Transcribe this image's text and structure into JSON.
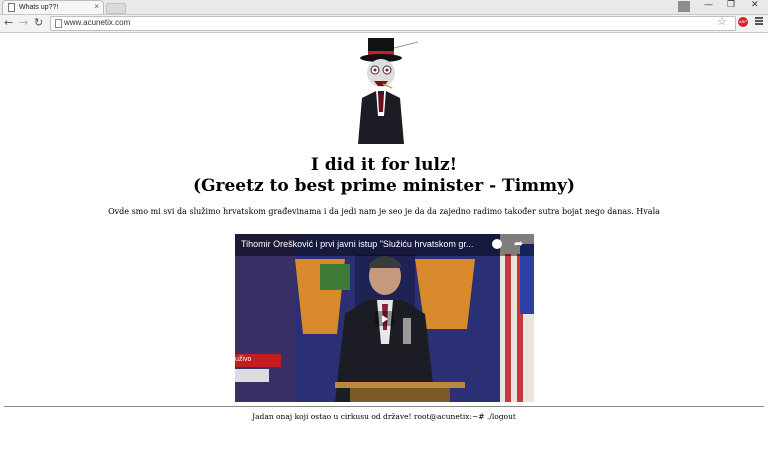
{
  "browser": {
    "tab_title": "Whats up??!",
    "tab_close": "×",
    "url": "www.acunetix.com",
    "window_controls": [
      "—",
      "❐",
      "✕"
    ],
    "nav": {
      "back": "←",
      "forward": "→",
      "reload": "↻"
    },
    "star_icon": "☆",
    "extension_badge": "ABP"
  },
  "page": {
    "headline_line1": "I did it for lulz!",
    "headline_line2": "(Greetz to best prime minister - Timmy)",
    "message": "Ovde smo mi svi da služimo hrvatskom građevinama i da jedi nam je seo je da da zajedno radimo također sutra bojat nego danas. Hvala",
    "video": {
      "title": "Tihomir Orešković i prvi javni istup \"Služiću hrvatskom gr...",
      "live_label": "uživo",
      "share_icon": "➦"
    },
    "footer": "Jadan onaj koji ostao u cirkusu od države! root@acunetix:~# ./logout"
  },
  "colors": {
    "live_red": "#c41d20",
    "video_bg": "#2b2f73",
    "adblock_red": "#d8202b"
  }
}
